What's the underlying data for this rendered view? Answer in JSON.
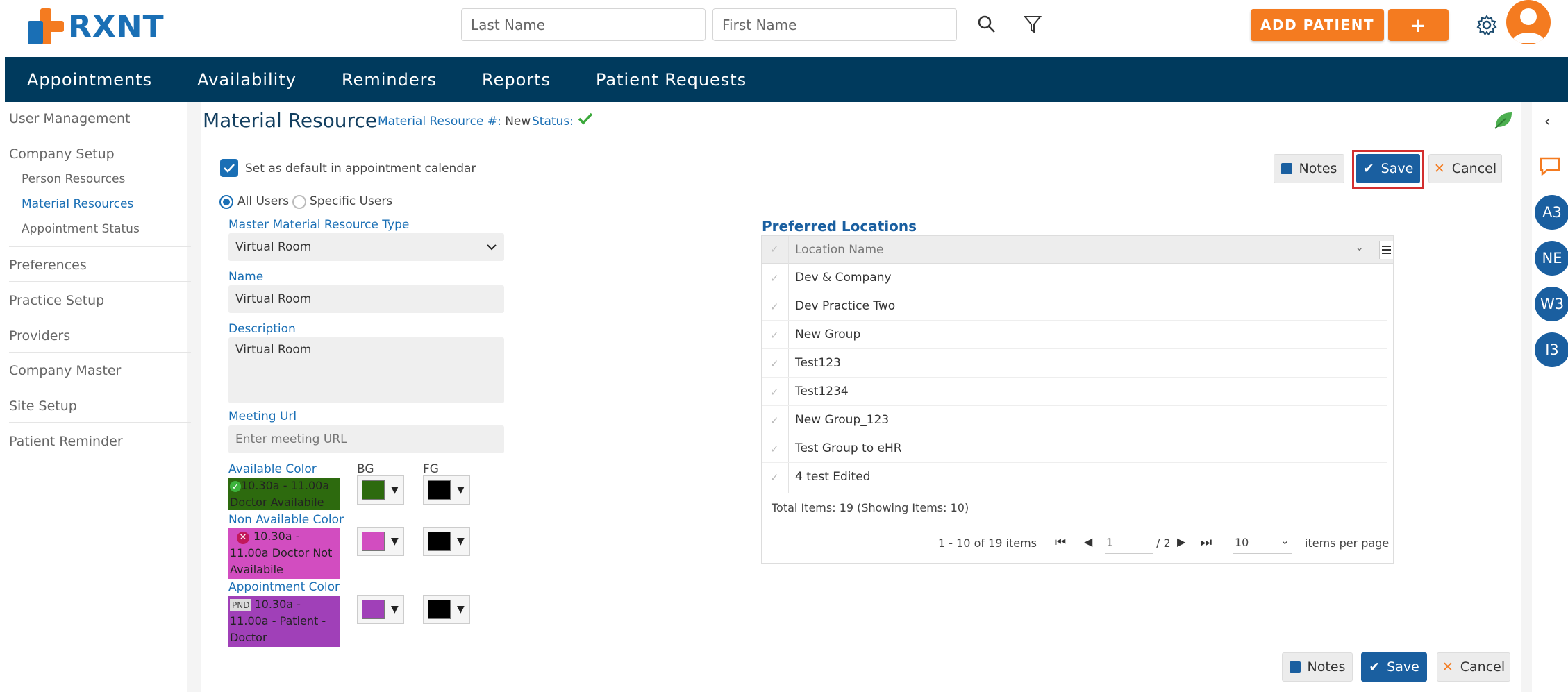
{
  "header": {
    "logo_text": "RXNT",
    "last_name_placeholder": "Last Name",
    "first_name_placeholder": "First Name",
    "add_patient_label": "ADD PATIENT",
    "plus_label": "+"
  },
  "nav": {
    "items": [
      "Appointments",
      "Availability",
      "Reminders",
      "Reports",
      "Patient Requests"
    ]
  },
  "sidebar": {
    "user_management": "User Management",
    "company_setup": "Company Setup",
    "person_resources": "Person Resources",
    "material_resources": "Material Resources",
    "appointment_status": "Appointment Status",
    "preferences": "Preferences",
    "practice_setup": "Practice Setup",
    "providers": "Providers",
    "company_master": "Company Master",
    "site_setup": "Site Setup",
    "patient_reminder": "Patient Reminder"
  },
  "page": {
    "title": "Material Resource",
    "resource_no_label": "Material Resource #:",
    "resource_no_value": "New",
    "status_label": "Status:"
  },
  "form": {
    "default_label": "Set as default in appointment calendar",
    "all_users": "All Users",
    "specific_users": "Specific Users",
    "type_label": "Master Material Resource Type",
    "type_value": "Virtual Room",
    "name_label": "Name",
    "name_value": "Virtual Room",
    "desc_label": "Description",
    "desc_value": "Virtual Room",
    "url_label": "Meeting Url",
    "url_placeholder": "Enter meeting URL",
    "available_color_label": "Available Color",
    "bg_label": "BG",
    "fg_label": "FG",
    "available_preview": "10.30a - 11.00a Doctor Availabile",
    "non_available_label": "Non Available Color",
    "non_available_preview": "10.30a - 11.00a Doctor Not Availabile",
    "appointment_color_label": "Appointment Color",
    "appointment_badge": "PND",
    "appointment_preview": "10.30a - 11.00a - Patient - Doctor",
    "colors": {
      "available_bg": "#2d6a0e",
      "non_available_bg": "#d24dc0",
      "appointment_bg": "#a040b8",
      "fg": "#000000"
    }
  },
  "actions": {
    "notes": "Notes",
    "save": "Save",
    "cancel": "Cancel"
  },
  "locations": {
    "title": "Preferred Locations",
    "column": "Location Name",
    "rows": [
      "Dev & Company",
      "Dev Practice Two",
      "New Group",
      "Test123",
      "Test1234",
      "New Group_123",
      "Test Group to eHR",
      "4 test Edited"
    ],
    "total": "Total Items: 19 (Showing Items: 10)",
    "range": "1 - 10 of 19 items",
    "page": "1",
    "page_total": "/ 2",
    "per_page": "10",
    "per_page_label": "items per page"
  },
  "rail": {
    "badges": [
      "A3",
      "NE",
      "W3",
      "I3"
    ]
  }
}
